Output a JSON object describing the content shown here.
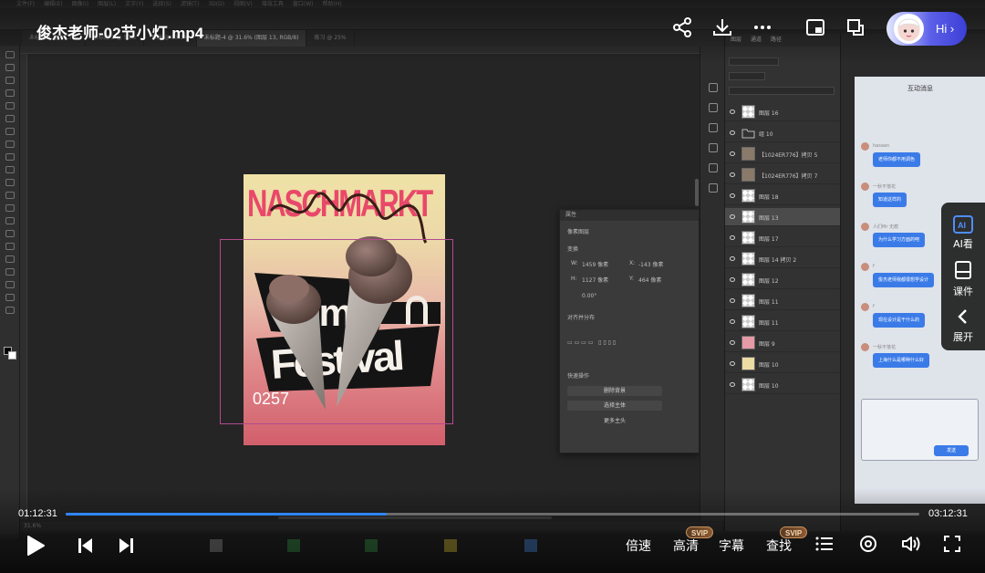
{
  "player": {
    "title": "俊杰老师-02节小灯.mp4",
    "hi_label": "Hi",
    "current_time": "01:12:31",
    "total_time": "03:12:31",
    "progress_percent": 37.6,
    "accent_color": "#2f86ff",
    "controls": {
      "speed_label": "倍速",
      "quality_label": "高清",
      "subtitle_label": "字幕",
      "search_label": "查找",
      "svip_badge": "SVIP"
    },
    "side_dock": [
      {
        "label": "AI看",
        "icon": "ai-watch-icon"
      },
      {
        "label": "课件",
        "icon": "courseware-icon"
      },
      {
        "label": "展开",
        "icon": "chevron-left-icon"
      }
    ]
  },
  "photoshop": {
    "poster": {
      "title_text": "NASCHMARKT",
      "center_text": "im",
      "festival_text": "Festival",
      "number_text": "0257"
    },
    "layers": [
      {
        "name": "图层 16",
        "thumb": "checker"
      },
      {
        "name": "组 10",
        "thumb": "folder"
      },
      {
        "name": "【1024ER776】拷贝 5",
        "thumb": "photo"
      },
      {
        "name": "【1024ER776】拷贝 7",
        "thumb": "photo"
      },
      {
        "name": "图层 18",
        "thumb": "checker"
      },
      {
        "name": "图层 13",
        "thumb": "checker",
        "selected": true
      },
      {
        "name": "图层 17",
        "thumb": "checker"
      },
      {
        "name": "图层 14 拷贝 2",
        "thumb": "checker"
      },
      {
        "name": "图层 12",
        "thumb": "checker"
      },
      {
        "name": "图层 11",
        "thumb": "checker"
      },
      {
        "name": "图层 11",
        "thumb": "checker"
      },
      {
        "name": "图层 9",
        "thumb": "pink"
      },
      {
        "name": "图层 10",
        "thumb": "yellow"
      },
      {
        "name": "图层 10",
        "thumb": "checker"
      }
    ],
    "properties": {
      "header": "属性",
      "kind": "像素图层",
      "section_transform": "变换",
      "w_value": "1459 像素",
      "x_value": "-143 像素",
      "h_value": "1127 像素",
      "y_value": "464 像素",
      "angle_value": "0.00°",
      "section_align": "对齐并分布",
      "section_quick": "快速操作",
      "btn_remove_bg": "删除背景",
      "btn_select_subject": "选择主体",
      "btn_more": "更多主头"
    },
    "chat": {
      "title": "互动消息",
      "messages": [
        {
          "name": "hasaan",
          "text": "老师你都不用调色"
        },
        {
          "name": "一秋不落花",
          "text": "知道这样的"
        },
        {
          "name": "人们Mr 无痕",
          "text": "为什么学习方面的吧"
        },
        {
          "name": "f",
          "text": "俊杰老师我都很想学设计"
        },
        {
          "name": "f",
          "text": "现在设计是干什么的"
        },
        {
          "name": "一秋不落花",
          "text": "上海什么是哪种什么好"
        }
      ],
      "send_label": "发送"
    }
  }
}
